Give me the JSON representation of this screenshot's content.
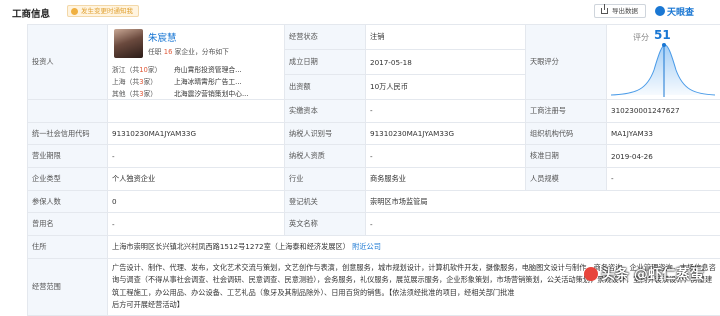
{
  "header": {
    "title": "工商信息",
    "tip": "发生变更时通知我",
    "export_label": "导出数据",
    "brand": "天眼查"
  },
  "legal_rep": {
    "label": "投资人",
    "name": "朱宸慧",
    "stat_prefix": "任职",
    "stat_count": "16",
    "stat_suffix": "家企业，分布如下",
    "regions": [
      {
        "region": "浙江（共",
        "count": "10",
        "suffix": "家）",
        "company": "舟山霄彤投资管理合..."
      },
      {
        "region": "上海（共",
        "count": "3",
        "suffix": "家）",
        "company": "上海冰晴霄彤广告工..."
      },
      {
        "region": "其他（共",
        "count": "3",
        "suffix": "家）",
        "company": "北海震汐营销策划中心..."
      }
    ]
  },
  "rating": {
    "label": "天眼评分",
    "score_label": "评分",
    "score": "51"
  },
  "fields": {
    "status_label": "经营状态",
    "status": "注销",
    "founded_label": "成立日期",
    "founded": "2017-05-18",
    "capital_label": "出资额",
    "capital": "10万人民币",
    "paid_label": "实缴资本",
    "paid": "-",
    "regno_label": "工商注册号",
    "regno": "310230001247627",
    "credit_label": "统一社会信用代码",
    "credit": "91310230MA1JYAM33G",
    "taxid_label": "纳税人识别号",
    "taxid": "91310230MA1JYAM33G",
    "orgcode_label": "组织机构代码",
    "orgcode": "MA1JYAM33",
    "term_label": "营业期限",
    "term": "-",
    "taxq_label": "纳税人资质",
    "taxq": "-",
    "approve_label": "核准日期",
    "approve": "2019-04-26",
    "type_label": "企业类型",
    "type": "个人独资企业",
    "industry_label": "行业",
    "industry": "商务服务业",
    "staff_label": "人员规模",
    "staff": "-",
    "insured_label": "参保人数",
    "insured": "0",
    "authority_label": "登记机关",
    "authority": "崇明区市场监管局",
    "oldname_label": "曾用名",
    "oldname": "-",
    "enname_label": "英文名称",
    "enname": "-",
    "address_label": "住所",
    "address": "上海市崇明区长兴镇北兴村凤西路1512号1272室（上海泰和经济发展区）",
    "nearby": "附近公司",
    "scope_label": "经营范围",
    "scope": "广告设计、制作、代理、发布，文化艺术交流与策划，文艺创作与表演，创意服务，城市规划设计，计算机软件开发，摄像服务，电脑图文设计与制作，商务咨询，企业管理咨询，市场信息咨询与调查（不得从事社会调查、社会调研、民意调查、民意测验），会务服务，礼仪服务，展览展示服务，企业形象策划，市场营销策划，公关活动策划，景观设计，室内外装潢设计，房屋建筑工程施工，办公用品、办公设备、工艺礼品（象牙及其制品除外）、日用百货的销售。【依法须经批准的项目，经相关部门批准",
    "scope_tail": "后方可开展经营活动】"
  },
  "watermark": "头条 @虾仁蒸蛋"
}
